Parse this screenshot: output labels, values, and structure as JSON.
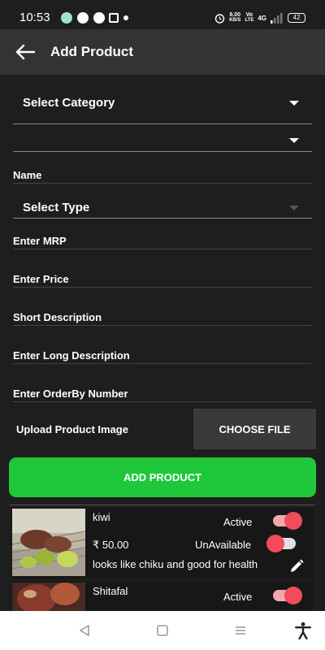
{
  "status_bar": {
    "time": "10:53",
    "net_speed_value": "8.00",
    "net_speed_unit": "KB/S",
    "volte_top": "Vo",
    "volte_bottom": "LTE",
    "network": "4G",
    "battery": "42",
    "icons": [
      "messages-app-icon",
      "chat-icon",
      "grid-app-icon",
      "sim-provider-icon",
      "notification-dot-icon",
      "alarm-icon",
      "signal-icon"
    ]
  },
  "app_bar": {
    "title": "Add Product",
    "back_icon": "arrow-left-icon"
  },
  "form": {
    "category_dropdown": "Select Category",
    "subcategory_dropdown": "",
    "name_label": "Name",
    "type_dropdown": "Select Type",
    "mrp_label": "Enter MRP",
    "price_label": "Enter Price",
    "short_desc_label": "Short Description",
    "long_desc_label": "Enter Long Description",
    "orderby_label": "Enter OrderBy Number",
    "upload_label": "Upload Product Image",
    "choose_file_button": "CHOOSE FILE",
    "add_product_button": "ADD PRODUCT"
  },
  "products": [
    {
      "name": "kiwi",
      "price": "₹ 50.00",
      "description": "looks like chiku and good for health",
      "active_label": "Active",
      "active": true,
      "available_label": "UnAvailable",
      "available": false
    },
    {
      "name": "Shitafal",
      "active_label": "Active",
      "active": true
    }
  ],
  "colors": {
    "background": "#1e1e1e",
    "app_bar": "#333333",
    "add_button": "#1ec83a",
    "toggle_knob": "#f24b5a",
    "toggle_track_on": "#f2a9ae"
  },
  "nav_bar": {
    "icons": [
      "back-triangle-icon",
      "home-square-icon",
      "recents-menu-icon",
      "accessibility-icon"
    ]
  }
}
